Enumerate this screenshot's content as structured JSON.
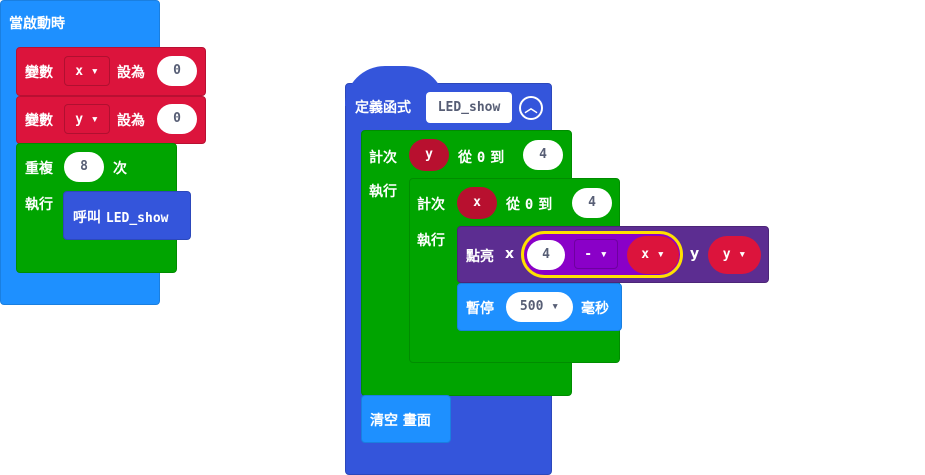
{
  "on_start": {
    "label": "當啟動時",
    "set_x": {
      "label": "變數",
      "var": "x",
      "to": "設為",
      "value": "0"
    },
    "set_y": {
      "label": "變數",
      "var": "y",
      "to": "設為",
      "value": "0"
    },
    "repeat": {
      "label": "重複",
      "count": "8",
      "times": "次",
      "do": "執行",
      "call": {
        "label": "呼叫",
        "name": "LED_show"
      }
    }
  },
  "function": {
    "label": "定義函式",
    "name": "LED_show",
    "for_y": {
      "label": "計次",
      "var": "y",
      "from": "從",
      "start": "0",
      "to": "到",
      "end": "4",
      "do": "執行",
      "for_x": {
        "label": "計次",
        "var": "x",
        "from": "從",
        "start": "0",
        "to": "到",
        "end": "4",
        "do": "執行",
        "plot": {
          "label": "點亮",
          "x_label": "x",
          "left": "4",
          "op": "-",
          "right": "x",
          "y_label": "y",
          "y_var": "y"
        },
        "pause": {
          "label": "暫停",
          "value": "500",
          "unit": "毫秒"
        }
      }
    },
    "clear": {
      "label": "清空 畫面"
    }
  },
  "colors": {
    "basic": "#1e90ff",
    "variables": "#dc143c",
    "loops": "#00a400",
    "functions": "#3455db",
    "led": "#5c2d91"
  }
}
